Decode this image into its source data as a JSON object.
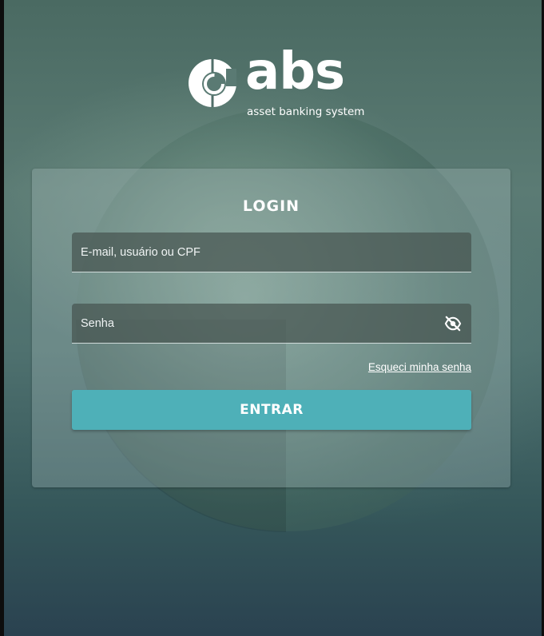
{
  "brand": {
    "name": "abs",
    "tagline": "asset banking system"
  },
  "login": {
    "title": "LOGIN",
    "email_placeholder": "E-mail, usuário ou CPF",
    "email_value": "",
    "password_placeholder": "Senha",
    "password_value": "",
    "password_toggle_icon": "eye-off-icon",
    "forgot_label": "Esqueci minha senha",
    "submit_label": "ENTRAR"
  },
  "colors": {
    "accent": "#4eb0b8",
    "text": "#ffffff"
  }
}
